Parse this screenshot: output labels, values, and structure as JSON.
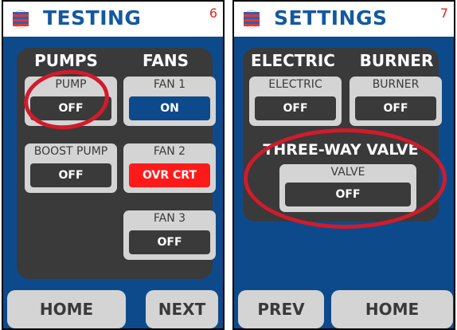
{
  "colors": {
    "background_blue": "#0d4a8c",
    "panel_gray": "#3a3a3a",
    "tile_light": "#d4d4d4",
    "title_blue": "#14599f",
    "page_num_red": "#e8221a",
    "status_on_blue": "#0d4a8c",
    "status_alarm_red": "#ff1a1a",
    "highlight_red": "#d11b2b"
  },
  "testing": {
    "title": "TESTING",
    "page_number": "6",
    "headers": {
      "pumps": "PUMPS",
      "fans": "FANS"
    },
    "tiles": {
      "pump": {
        "label": "PUMP",
        "status": "OFF"
      },
      "boost_pump": {
        "label": "BOOST PUMP",
        "status": "OFF"
      },
      "fan1": {
        "label": "FAN 1",
        "status": "ON"
      },
      "fan2": {
        "label": "FAN 2",
        "status": "OVR CRT"
      },
      "fan3": {
        "label": "FAN 3",
        "status": "OFF"
      }
    },
    "buttons": {
      "home": "HOME",
      "next": "NEXT"
    }
  },
  "settings": {
    "title": "SETTINGS",
    "page_number": "7",
    "headers": {
      "electric": "ELECTRIC",
      "burner": "BURNER"
    },
    "section_label": "THREE-WAY VALVE",
    "tiles": {
      "electric": {
        "label": "ELECTRIC",
        "status": "OFF"
      },
      "burner": {
        "label": "BURNER",
        "status": "OFF"
      },
      "valve": {
        "label": "VALVE",
        "status": "OFF"
      }
    },
    "buttons": {
      "prev": "PREV",
      "home": "HOME"
    }
  }
}
